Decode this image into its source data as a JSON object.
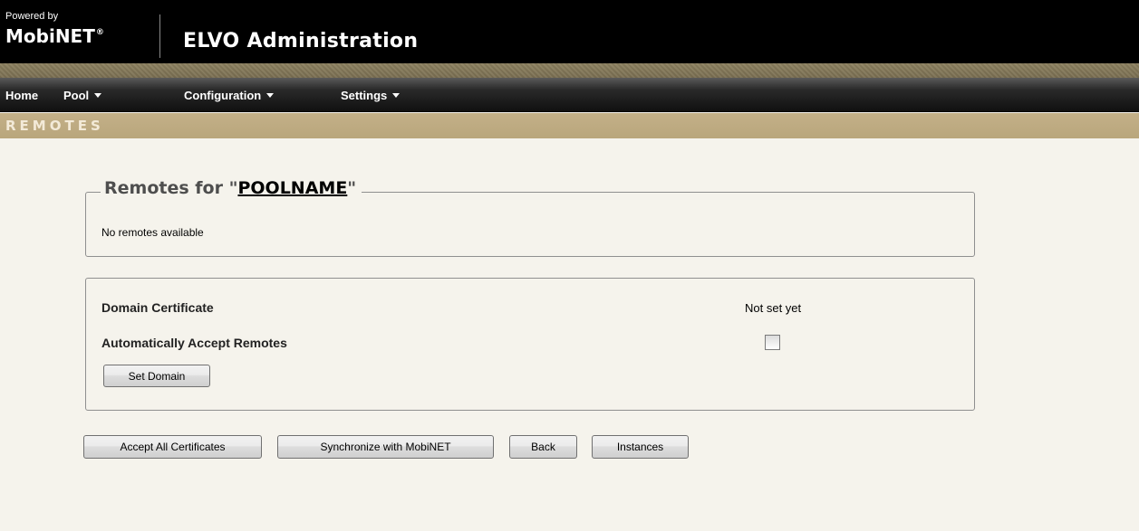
{
  "header": {
    "powered_by": "Powered by",
    "brand": "MobiNET",
    "brand_mark": "®",
    "app_title": "ELVO Administration"
  },
  "nav": {
    "items": [
      {
        "label": "Home",
        "has_dropdown": false
      },
      {
        "label": "Pool",
        "has_dropdown": true
      },
      {
        "label": "Configuration",
        "has_dropdown": true
      },
      {
        "label": "Settings",
        "has_dropdown": true
      }
    ]
  },
  "section": {
    "title": "REMOTES"
  },
  "remotes_panel": {
    "legend_prefix": "Remotes for \"",
    "pool_name": "POOLNAME",
    "legend_suffix": "\"",
    "empty_message": "No remotes available"
  },
  "domain_panel": {
    "certificate_label": "Domain Certificate",
    "certificate_status": "Not set yet",
    "auto_accept_label": "Automatically Accept Remotes",
    "auto_accept_checked": false,
    "set_domain_button": "Set Domain"
  },
  "actions": {
    "accept_all": "Accept All Certificates",
    "synchronize": "Synchronize with MobiNET",
    "back": "Back",
    "instances": "Instances"
  },
  "colors": {
    "header_bg": "#000000",
    "texture_band": "#857a5b",
    "section_band": "#beab82",
    "section_title": "#f3ead8",
    "page_bg": "#f5f3ec"
  }
}
